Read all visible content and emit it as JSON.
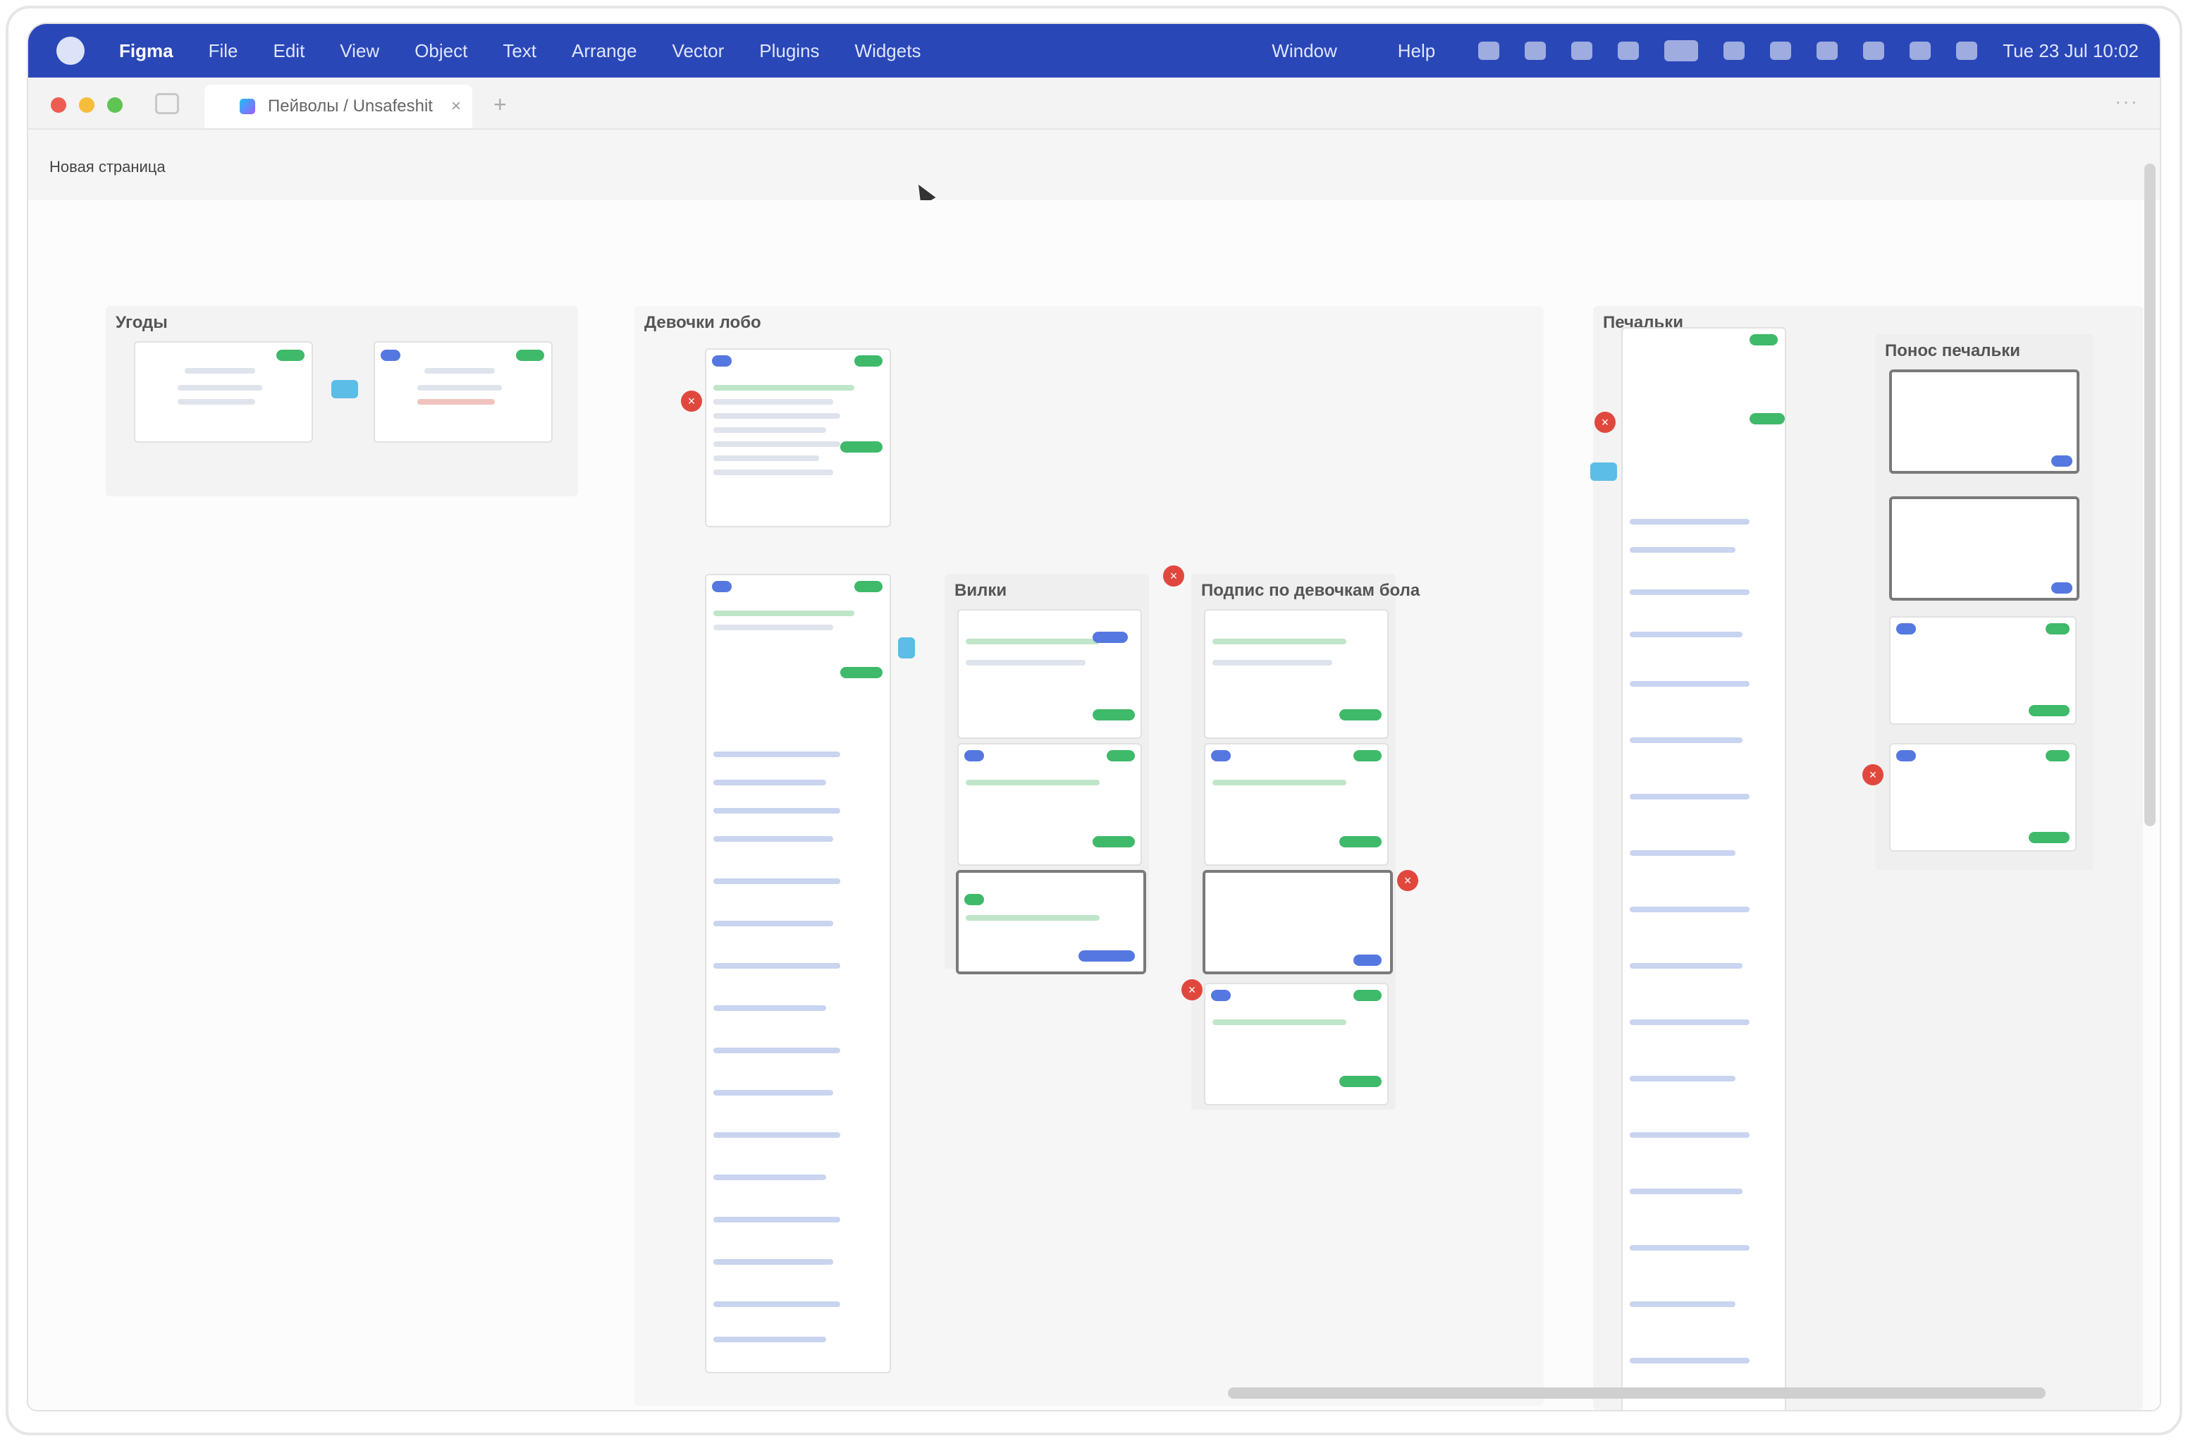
{
  "menubar": {
    "app_name": "Figma",
    "items": [
      "File",
      "Edit",
      "View",
      "Object",
      "Text",
      "Arrange",
      "Vector",
      "Plugins",
      "Widgets"
    ],
    "right_items": [
      "Window",
      "Help"
    ],
    "clock": "Tue 23 Jul 10:02"
  },
  "tabbar": {
    "tab_title": "Пейволы / Unsafeshit",
    "close_glyph": "×",
    "new_tab_glyph": "+",
    "more_glyph": "···"
  },
  "canvas": {
    "crumb": "Новая страница",
    "sections": [
      {
        "title": "Угоды"
      },
      {
        "title": "Девочки лобо"
      },
      {
        "title": "Вилки"
      },
      {
        "title": "Подпис по девочкам бола"
      },
      {
        "title": "Печальки"
      },
      {
        "title": "Понос печальки"
      }
    ],
    "badge_glyph": "×"
  },
  "colors": {
    "menubar": "#2a47b8",
    "accent_green": "#3fb96a",
    "accent_blue": "#5577e0",
    "badge_red": "#e0483e",
    "connector_blue": "#5cbde6"
  }
}
